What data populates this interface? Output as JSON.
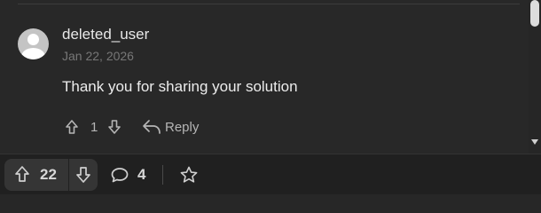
{
  "comment": {
    "username": "deleted_user",
    "date": "Jan 22, 2026",
    "text": "Thank you for sharing your solution",
    "vote_count": "1",
    "reply_label": "Reply",
    "avatar_icon": "default-user-avatar"
  },
  "toolbar": {
    "upvote_count": "22",
    "comment_count": "4",
    "icons": [
      "arrow-up-icon",
      "arrow-down-icon",
      "comment-bubble-icon",
      "star-icon"
    ]
  },
  "colors": {
    "background": "#272727",
    "bar_background": "#202020",
    "pill_background": "#353535",
    "text_primary": "#ececec",
    "text_muted": "#777777",
    "icon_color": "#b5b5b5"
  }
}
